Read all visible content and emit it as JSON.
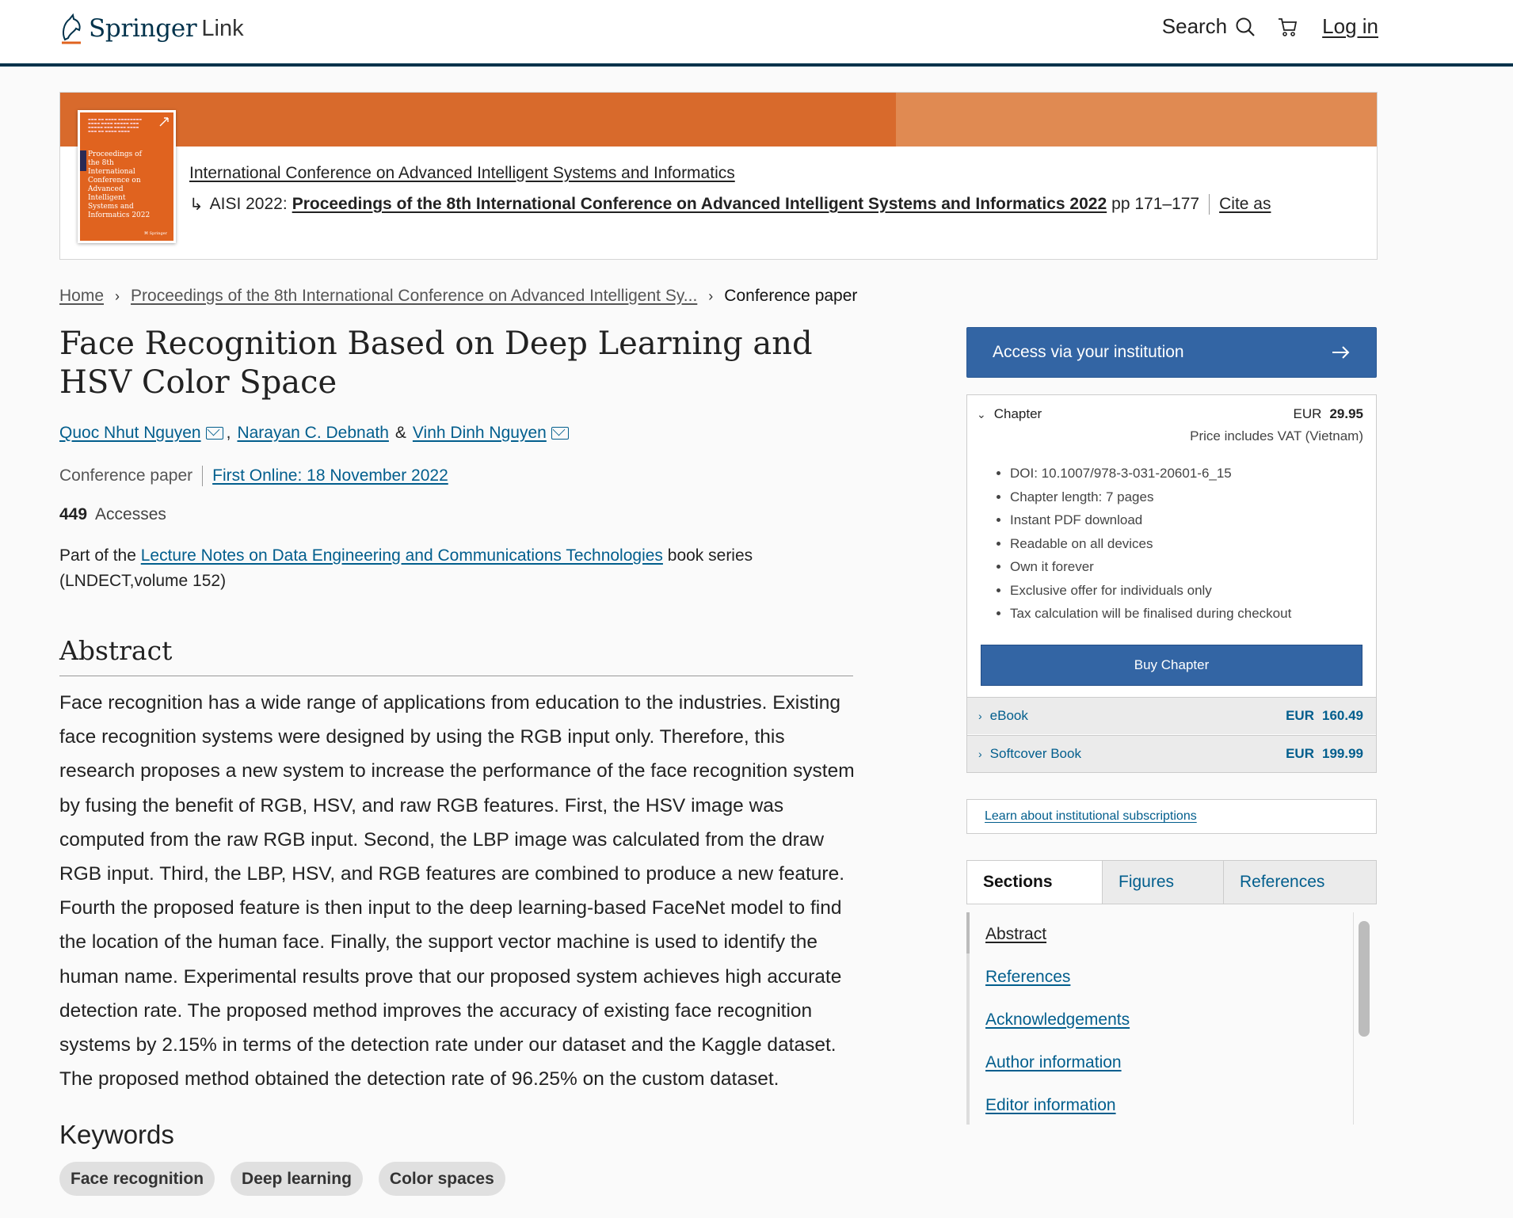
{
  "header": {
    "brand": "Springer",
    "brand_suffix": "Link",
    "search_label": "Search",
    "login_label": "Log in"
  },
  "banner": {
    "series_link": "International Conference on Advanced Intelligent Systems and Informatics",
    "prefix": "AISI 2022:",
    "proceedings_link": "Proceedings of the 8th International Conference on Advanced Intelligent Systems and Informatics 2022",
    "pages": "pp 171–177",
    "cite_label": "Cite as",
    "cover_lines": "Proceedings of the 8th International Conference on Advanced Intelligent Systems and Informatics 2022"
  },
  "breadcrumb": {
    "home": "Home",
    "proceedings": "Proceedings of the 8th International Conference on Advanced Intelligent Sy...",
    "current": "Conference paper"
  },
  "article": {
    "title": "Face Recognition Based on Deep Learning and HSV Color Space",
    "authors": [
      "Quoc Nhut Nguyen",
      "Narayan C. Debnath",
      "Vinh Dinh Nguyen"
    ],
    "author_sep_1": ",",
    "author_sep_2": "&",
    "type": "Conference paper",
    "first_online": "First Online: 18 November 2022",
    "accesses_count": "449",
    "accesses_label": "Accesses",
    "part_of_prefix": "Part of the",
    "series_name": "Lecture Notes on Data Engineering and Communications Technologies",
    "part_of_suffix": "book series (LNDECT,volume 152)",
    "abstract_heading": "Abstract",
    "abstract": "Face recognition has a wide range of applications from education to the industries. Existing face recognition systems were designed by using the RGB input only. Therefore, this research proposes a new system to increase the performance of the face recognition system by fusing the benefit of RGB, HSV, and raw RGB features. First, the HSV image was computed from the raw RGB input. Second, the LBP image was calculated from the draw RGB input. Third, the LBP, HSV, and RGB features are combined to produce a new feature. Fourth the proposed feature is then input to the deep learning-based FaceNet model to find the location of the human face. Finally, the support vector machine is used to identify the human name. Experimental results prove that our proposed system achieves high accurate detection rate. The proposed method improves the accuracy of existing face recognition systems by 2.15% in terms of the detection rate under our dataset and the Kaggle dataset. The proposed method obtained the detection rate of 96.25% on the custom dataset.",
    "keywords_heading": "Keywords",
    "keywords": [
      "Face recognition",
      "Deep learning",
      "Color spaces"
    ]
  },
  "sidebar": {
    "access_button": "Access via your institution",
    "chapter": {
      "label": "Chapter",
      "currency": "EUR",
      "price": "29.95",
      "vat_note": "Price includes VAT (Vietnam)",
      "features": [
        "DOI: 10.1007/978-3-031-20601-6_15",
        "Chapter length: 7 pages",
        "Instant PDF download",
        "Readable on all devices",
        "Own it forever",
        "Exclusive offer for individuals only",
        "Tax calculation will be finalised during checkout"
      ],
      "buy_label": "Buy Chapter"
    },
    "ebook": {
      "label": "eBook",
      "currency": "EUR",
      "price": "160.49"
    },
    "softcover": {
      "label": "Softcover Book",
      "currency": "EUR",
      "price": "199.99"
    },
    "learn_link": "Learn about institutional subscriptions",
    "tabs": [
      "Sections",
      "Figures",
      "References"
    ],
    "sections": [
      "Abstract",
      "References",
      "Acknowledgements",
      "Author information",
      "Editor information"
    ]
  },
  "colors": {
    "brand_navy": "#01324b",
    "link_blue": "#025e8d",
    "button_blue": "#3365a4",
    "banner_orange": "#d86a2c"
  }
}
